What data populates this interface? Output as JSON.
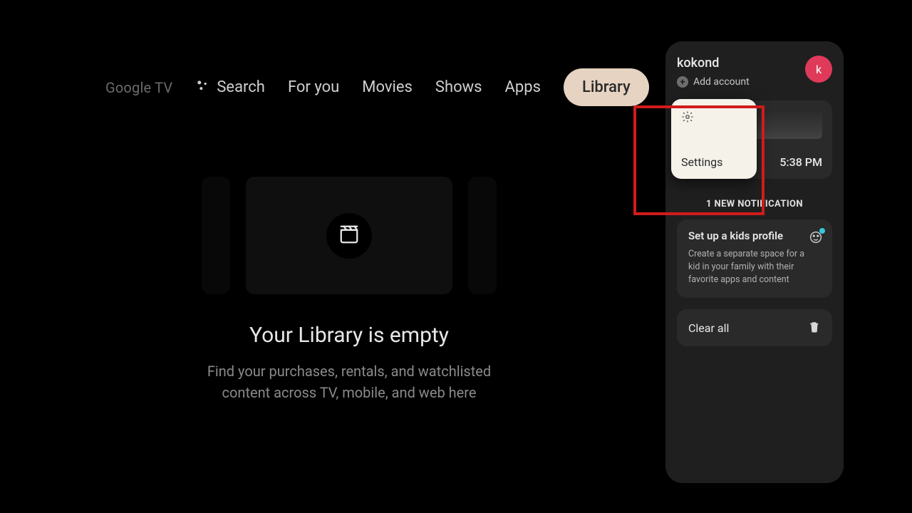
{
  "brand": "Google TV",
  "nav": {
    "search": "Search",
    "for_you": "For you",
    "movies": "Movies",
    "shows": "Shows",
    "apps": "Apps",
    "library": "Library"
  },
  "library": {
    "title": "Your Library is empty",
    "subtitle1": "Find your purchases, rentals, and watchlisted",
    "subtitle2": "content across TV, mobile, and web here"
  },
  "panel": {
    "account": {
      "name": "kokond",
      "add": "Add account",
      "initial": "k"
    },
    "settings": {
      "label": "Settings"
    },
    "time": "5:38 PM",
    "notif_header": "1 NEW NOTIFICATION",
    "kids": {
      "title": "Set up a kids profile",
      "desc": "Create a separate space for a kid in your family with their favorite apps and content"
    },
    "clear": "Clear all"
  }
}
